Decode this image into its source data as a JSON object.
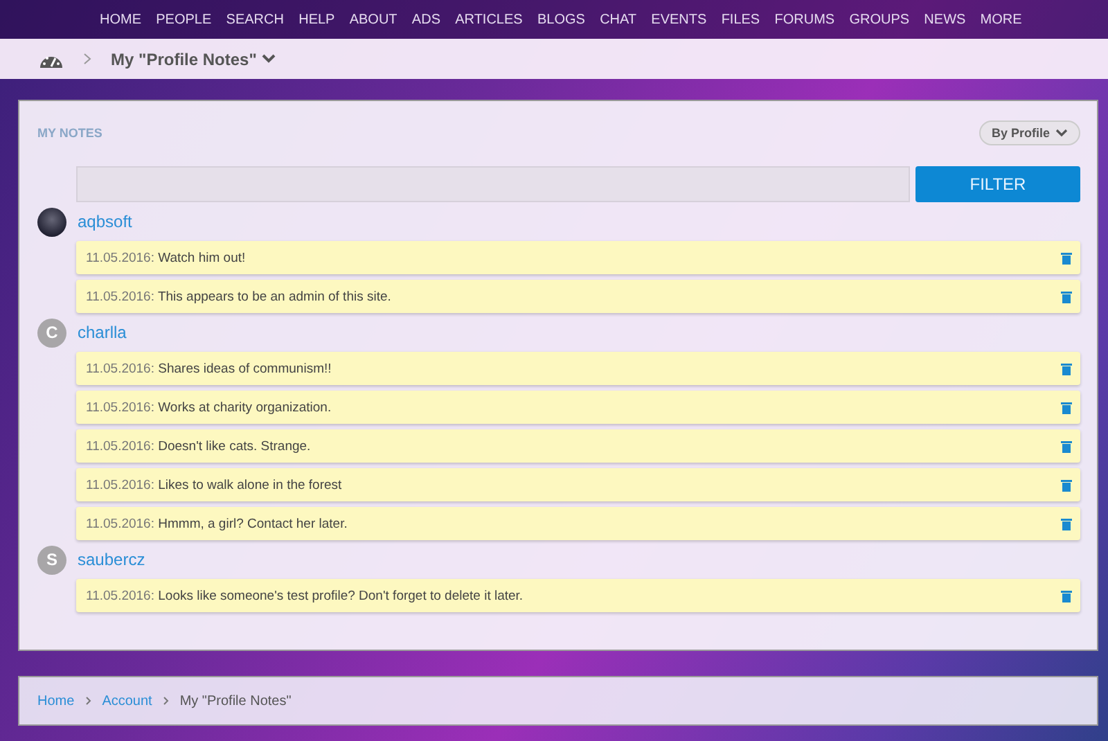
{
  "top_nav": [
    "HOME",
    "PEOPLE",
    "SEARCH",
    "HELP",
    "ABOUT",
    "ADS",
    "ARTICLES",
    "BLOGS",
    "CHAT",
    "EVENTS",
    "FILES",
    "FORUMS",
    "GROUPS",
    "NEWS",
    "MORE"
  ],
  "title_bar": {
    "title": "My \"Profile Notes\""
  },
  "panel": {
    "heading": "MY NOTES",
    "sort_button": "By Profile",
    "filter_button": "FILTER",
    "groups": [
      {
        "user": "aqbsoft",
        "kind": "photo",
        "notes": [
          {
            "date": "11.05.2016:",
            "text": "Watch him out!"
          },
          {
            "date": "11.05.2016:",
            "text": "This appears to be an admin of this site."
          }
        ]
      },
      {
        "user": "charlla",
        "kind": "letter",
        "initial": "C",
        "notes": [
          {
            "date": "11.05.2016:",
            "text": "Shares ideas of communism!!"
          },
          {
            "date": "11.05.2016:",
            "text": "Works at charity organization."
          },
          {
            "date": "11.05.2016:",
            "text": "Doesn't like cats. Strange."
          },
          {
            "date": "11.05.2016:",
            "text": "Likes to walk alone in the forest"
          },
          {
            "date": "11.05.2016:",
            "text": "Hmmm, a girl? Contact her later."
          }
        ]
      },
      {
        "user": "saubercz",
        "kind": "letter",
        "initial": "S",
        "notes": [
          {
            "date": "11.05.2016:",
            "text": "Looks like someone's test profile? Don't forget to delete it later."
          }
        ]
      }
    ]
  },
  "breadcrumb": [
    {
      "label": "Home",
      "kind": "link"
    },
    {
      "label": "Account",
      "kind": "link"
    },
    {
      "label": "My \"Profile Notes\"",
      "kind": "current"
    }
  ]
}
